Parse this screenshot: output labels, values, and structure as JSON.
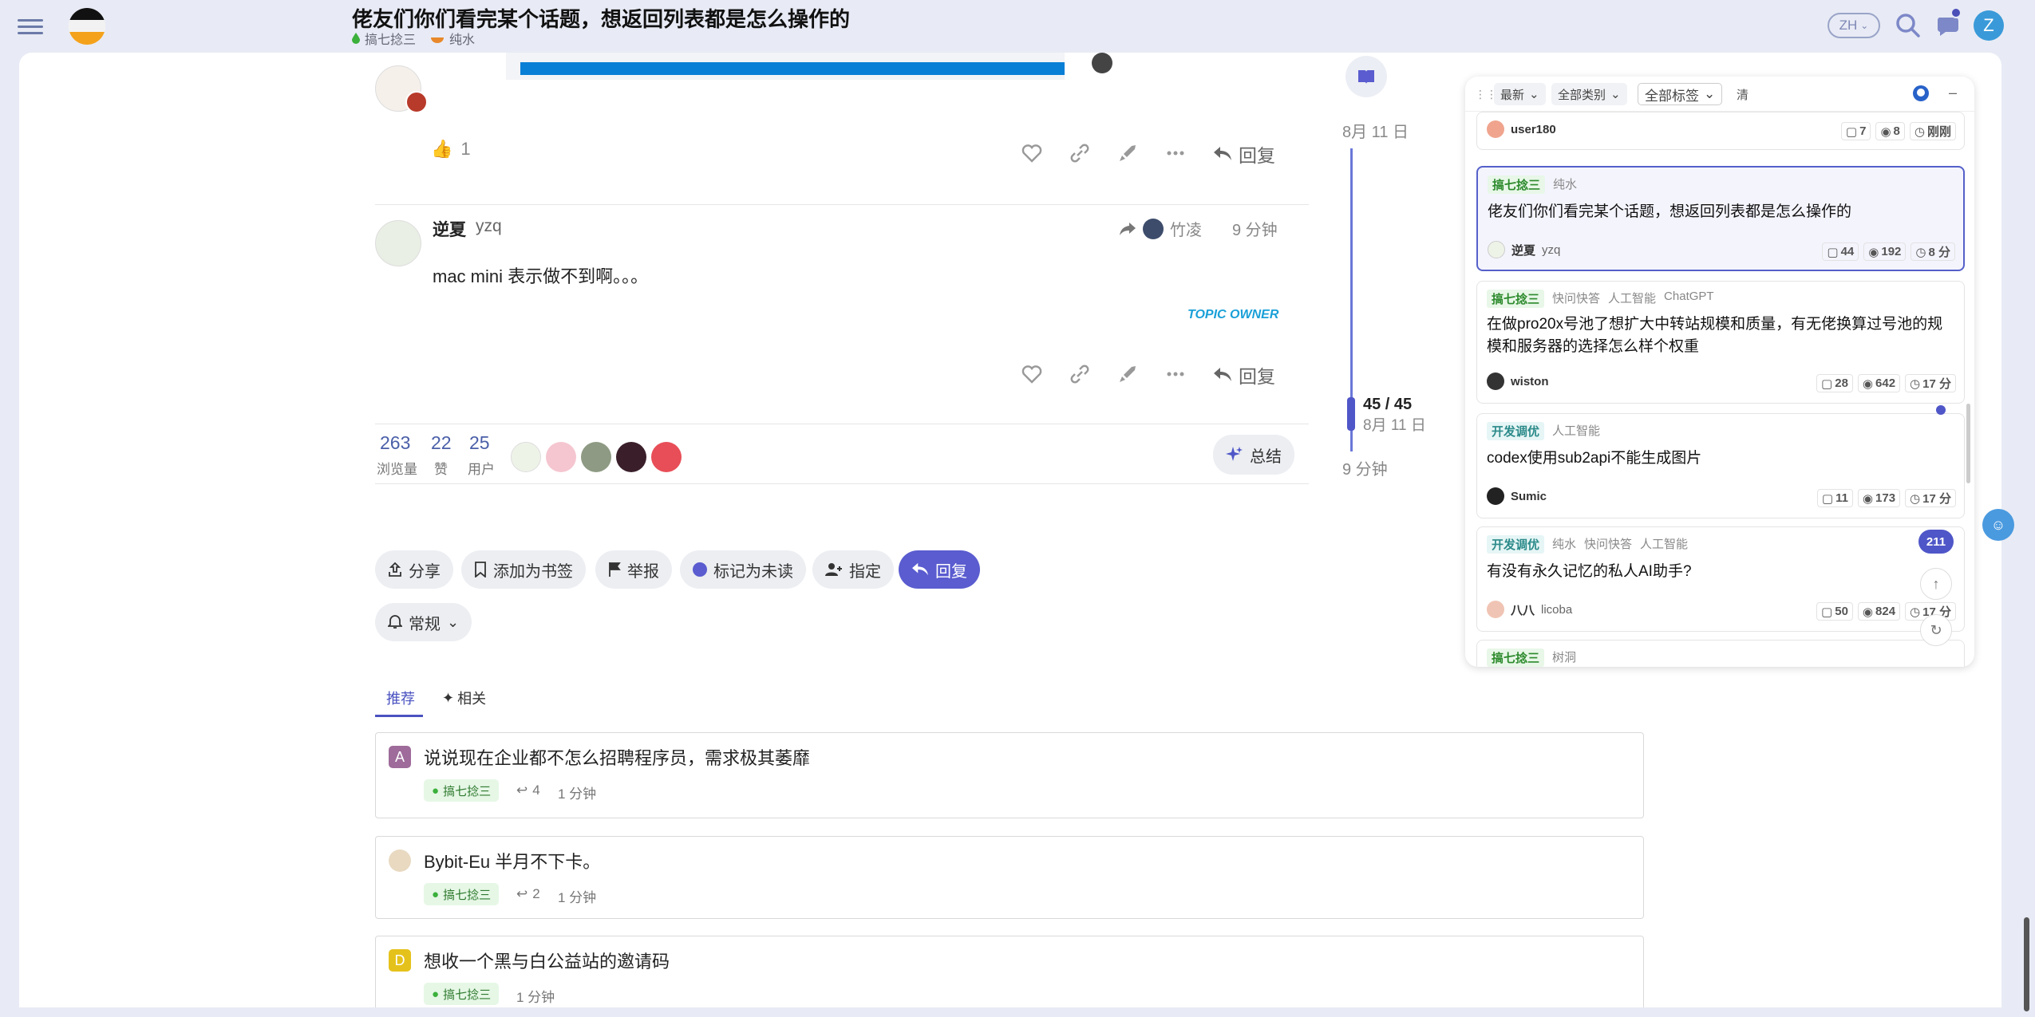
{
  "header": {
    "title": "佬友们你们看完某个话题，想返回列表都是怎么操作的",
    "tags": [
      "搞七捻三",
      "纯水"
    ],
    "lang": "ZH",
    "avatar_letter": "Z"
  },
  "post1": {
    "like_count": "1",
    "reply_label": "回复"
  },
  "post2": {
    "author": "逆夏",
    "username": "yzq",
    "reply_to": "竹凌",
    "time": "9 分钟",
    "body": "mac mini 表示做不到啊。。。",
    "owner_label": "TOPIC OWNER",
    "reply_label": "回复"
  },
  "stats": [
    {
      "n": "263",
      "label": "浏览量"
    },
    {
      "n": "22",
      "label": "赞"
    },
    {
      "n": "25",
      "label": "用户"
    }
  ],
  "summary_label": "总结",
  "actions": {
    "share": "分享",
    "bookmark": "添加为书签",
    "flag": "举报",
    "unread": "标记为未读",
    "assign": "指定",
    "reply": "回复",
    "notify": "常规"
  },
  "timeline": {
    "top_date": "8月 11 日",
    "progress": "45 / 45",
    "progress_date": "8月 11 日",
    "bottom": "9 分钟"
  },
  "tabs": [
    "推荐",
    "相关"
  ],
  "suggested": [
    {
      "avatar": "A",
      "color": "#9e6b9a",
      "title": "说说现在企业都不怎么招聘程序员，需求极其萎靡",
      "category": "搞七捻三",
      "replies": "4",
      "time": "1 分钟"
    },
    {
      "avatar": "",
      "color": "#e8d9c0",
      "title": "Bybit-Eu 半月不下卡。",
      "category": "搞七捻三",
      "replies": "2",
      "time": "1 分钟"
    },
    {
      "avatar": "D",
      "color": "#e5c21b",
      "title": "想收一个黑与白公益站的邀请码",
      "category": "搞七捻三",
      "replies": "",
      "time": "1 分钟"
    }
  ],
  "panel": {
    "filters": [
      "最新",
      "全部类别",
      "全部标签",
      "清"
    ],
    "items": [
      {
        "author": "user180",
        "username": "",
        "replies": "7",
        "views": "8",
        "time": "刚刚"
      },
      {
        "tags": [
          "搞七捻三",
          "纯水"
        ],
        "title": "佬友们你们看完某个话题，想返回列表都是怎么操作的",
        "author": "逆夏",
        "username": "yzq",
        "replies": "44",
        "views": "192",
        "time": "8 分"
      },
      {
        "tags": [
          "搞七捻三",
          "快问快答",
          "人工智能",
          "ChatGPT"
        ],
        "title": "在做pro20x号池了想扩大中转站规模和质量，有无佬换算过号池的规模和服务器的选择怎么样个权重",
        "author": "wiston",
        "username": "",
        "replies": "28",
        "views": "642",
        "time": "17 分"
      },
      {
        "tags": [
          "开发调优",
          "人工智能"
        ],
        "title": "codex使用sub2api不能生成图片",
        "author": "Sumic",
        "username": "",
        "replies": "11",
        "views": "173",
        "time": "17 分"
      },
      {
        "tags": [
          "开发调优",
          "纯水",
          "快问快答",
          "人工智能"
        ],
        "title": "有没有永久记忆的私人AI助手?",
        "author": "八八",
        "username": "licoba",
        "replies": "50",
        "views": "824",
        "time": "17 分"
      },
      {
        "tags": [
          "搞七捻三",
          "树洞"
        ]
      }
    ],
    "unread_badge": "211"
  }
}
